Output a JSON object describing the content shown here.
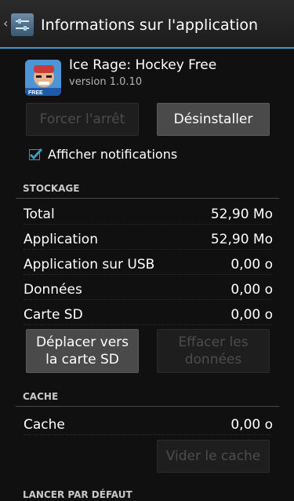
{
  "header": {
    "title": "Informations sur l'application",
    "up_caret": "‹"
  },
  "app": {
    "name": "Ice Rage: Hockey Free",
    "version": "version 1.0.10",
    "icon_badge": "FREE"
  },
  "buttons": {
    "force_stop": "Forcer l'arrêt",
    "uninstall": "Désinstaller",
    "move_to_sd": "Déplacer vers la carte SD",
    "clear_data": "Effacer les données",
    "clear_cache": "Vider le cache"
  },
  "notifications": {
    "label": "Afficher notifications",
    "checked": true
  },
  "storage": {
    "header": "STOCKAGE",
    "rows": [
      {
        "label": "Total",
        "value": "52,90 Mo"
      },
      {
        "label": "Application",
        "value": "52,90 Mo"
      },
      {
        "label": "Application sur USB",
        "value": "0,00 o"
      },
      {
        "label": "Données",
        "value": "0,00 o"
      },
      {
        "label": "Carte SD",
        "value": "0,00 o"
      }
    ]
  },
  "cache": {
    "header": "CACHE",
    "rows": [
      {
        "label": "Cache",
        "value": "0,00 o"
      }
    ]
  },
  "launch_default": {
    "header": "LANCER PAR DÉFAUT"
  },
  "colors": {
    "accent": "#3b9bc5",
    "background": "#101010",
    "button_enabled": "#4a4a4a",
    "button_disabled_text": "#4c4c4c"
  }
}
